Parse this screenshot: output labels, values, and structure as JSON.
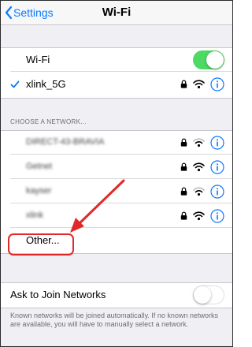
{
  "nav": {
    "back_label": "Settings",
    "title": "Wi-Fi"
  },
  "wifi_toggle": {
    "label": "Wi-Fi",
    "on": true
  },
  "connected": {
    "name": "xlink_5G",
    "icons": [
      "checkmark-icon",
      "lock-icon",
      "wifi-icon",
      "info-icon"
    ]
  },
  "choose_header": "CHOOSE A NETWORK...",
  "networks": [
    {
      "name": "DIRECT-43-BRAVIA",
      "obscured": true
    },
    {
      "name": "Getnet",
      "obscured": true
    },
    {
      "name": "kayser",
      "obscured": true
    },
    {
      "name": "xlink",
      "obscured": true
    }
  ],
  "other_label": "Other...",
  "ask_join": {
    "label": "Ask to Join Networks",
    "on": false
  },
  "footer_text": "Known networks will be joined automatically. If no known networks are available, you will have to manually select a network.",
  "colors": {
    "accent": "#0a7aff",
    "toggle_on": "#4cd964",
    "annotation": "#e02a2a",
    "background": "#efeff4"
  }
}
